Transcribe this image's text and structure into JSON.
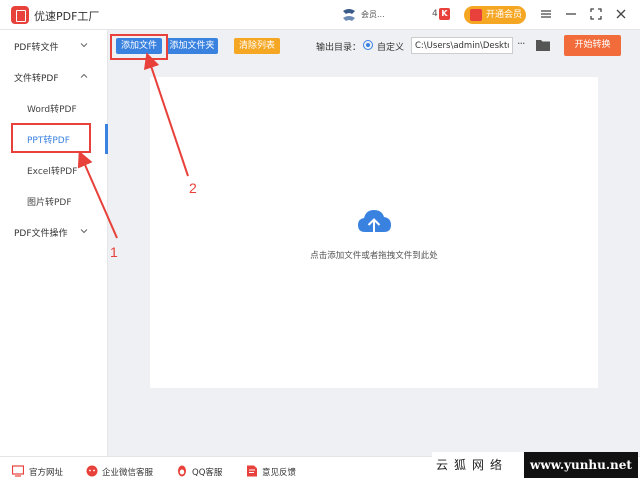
{
  "app": {
    "title": "优速PDF工厂",
    "user_label": "会员...",
    "notice_count": "4",
    "k_badge": "K",
    "vip_label": "开通会员"
  },
  "sidebar": {
    "groups": [
      {
        "label": "PDF转文件",
        "chevron": "chevron-down-icon"
      },
      {
        "label": "文件转PDF",
        "chevron": "chevron-up-icon"
      },
      {
        "label": "PDF文件操作",
        "chevron": "chevron-down-icon"
      }
    ],
    "items": [
      {
        "label": "Word转PDF"
      },
      {
        "label": "PPT转PDF",
        "active": true
      },
      {
        "label": "Excel转PDF"
      },
      {
        "label": "图片转PDF"
      }
    ]
  },
  "toolbar": {
    "add_file": "添加文件",
    "add_folder": "添加文件夹",
    "clear_list": "清除列表",
    "output_label": "输出目录：",
    "custom_label": "自定义",
    "output_path": "C:\\Users\\admin\\Deskto",
    "more": "···",
    "start": "开始转换"
  },
  "dropzone": {
    "hint": "点击添加文件或者拖拽文件到此处",
    "icon": "cloud-upload-icon"
  },
  "footer": {
    "website": "官方网址",
    "wechat": "企业微信客服",
    "qq": "QQ客服",
    "feedback": "意见反馈"
  },
  "watermark": {
    "cn": "云狐网络",
    "url": "www.yunhu.net"
  },
  "annotations": {
    "step1": "1",
    "step2": "2"
  },
  "colors": {
    "accent_blue": "#3a82e0",
    "accent_red": "#e8403a",
    "vip_orange": "#f5a623",
    "start_orange": "#f26b3a",
    "clear_orange": "#f5a623"
  }
}
